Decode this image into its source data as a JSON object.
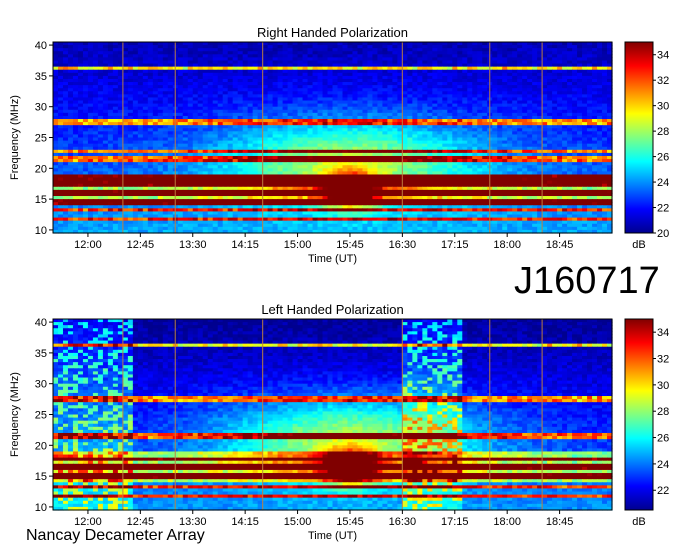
{
  "page": {
    "panel_id": "J160717",
    "footer_label": "Nancay Decameter Array"
  },
  "chart_data": [
    {
      "type": "heatmap",
      "title": "Right Handed Polarization",
      "xlabel": "Time (UT)",
      "ylabel": "Frequency (MHz)",
      "x_ticks": [
        "12:00",
        "12:45",
        "13:30",
        "14:15",
        "15:00",
        "15:45",
        "16:30",
        "17:15",
        "18:00",
        "18:45"
      ],
      "x_range": [
        "11:30",
        "19:30"
      ],
      "y_ticks": [
        10,
        15,
        20,
        25,
        30,
        35,
        40
      ],
      "ylim": [
        9.5,
        40.5
      ],
      "colorbar": {
        "label": "dB",
        "ticks": [
          20,
          22,
          24,
          26,
          28,
          30,
          32,
          34
        ],
        "range": [
          20,
          35
        ]
      },
      "colormap": [
        "#00008f",
        "#0000ff",
        "#0080ff",
        "#00ffff",
        "#80ff80",
        "#ffff00",
        "#ff8000",
        "#ff0000",
        "#800000"
      ],
      "grid": false,
      "notes_visible_features": {
        "strong_bursts": [
          {
            "time": "15:45",
            "freq_center": 16.5,
            "level": 35
          }
        ],
        "persistent_bands_mhz": [
          11.8,
          13.2,
          14.5,
          16.0,
          17.5,
          18.5,
          21.5,
          22.8,
          27.5,
          36.3
        ]
      }
    },
    {
      "type": "heatmap",
      "title": "Left Handed Polarization",
      "xlabel": "Time (UT)",
      "ylabel": "Frequency (MHz)",
      "x_ticks": [
        "12:00",
        "12:45",
        "13:30",
        "14:15",
        "15:00",
        "15:45",
        "16:30",
        "17:15",
        "18:00",
        "18:45"
      ],
      "x_range": [
        "11:30",
        "19:30"
      ],
      "y_ticks": [
        10,
        15,
        20,
        25,
        30,
        35,
        40
      ],
      "ylim": [
        9.5,
        40.5
      ],
      "colorbar": {
        "label": "dB",
        "ticks": [
          22,
          24,
          26,
          28,
          30,
          32,
          34
        ],
        "range": [
          20.5,
          35
        ]
      },
      "colormap": [
        "#00008f",
        "#0000ff",
        "#0080ff",
        "#00ffff",
        "#80ff80",
        "#ffff00",
        "#ff8000",
        "#ff0000",
        "#800000"
      ],
      "grid": false,
      "notes_visible_features": {
        "strong_bursts": [
          {
            "time": "15:45",
            "freq_center": 16.5,
            "level": 35
          }
        ],
        "persistent_bands_mhz": [
          11.8,
          13.2,
          15.0,
          16.5,
          17.8,
          21.5,
          27.5,
          36.3
        ]
      }
    }
  ]
}
